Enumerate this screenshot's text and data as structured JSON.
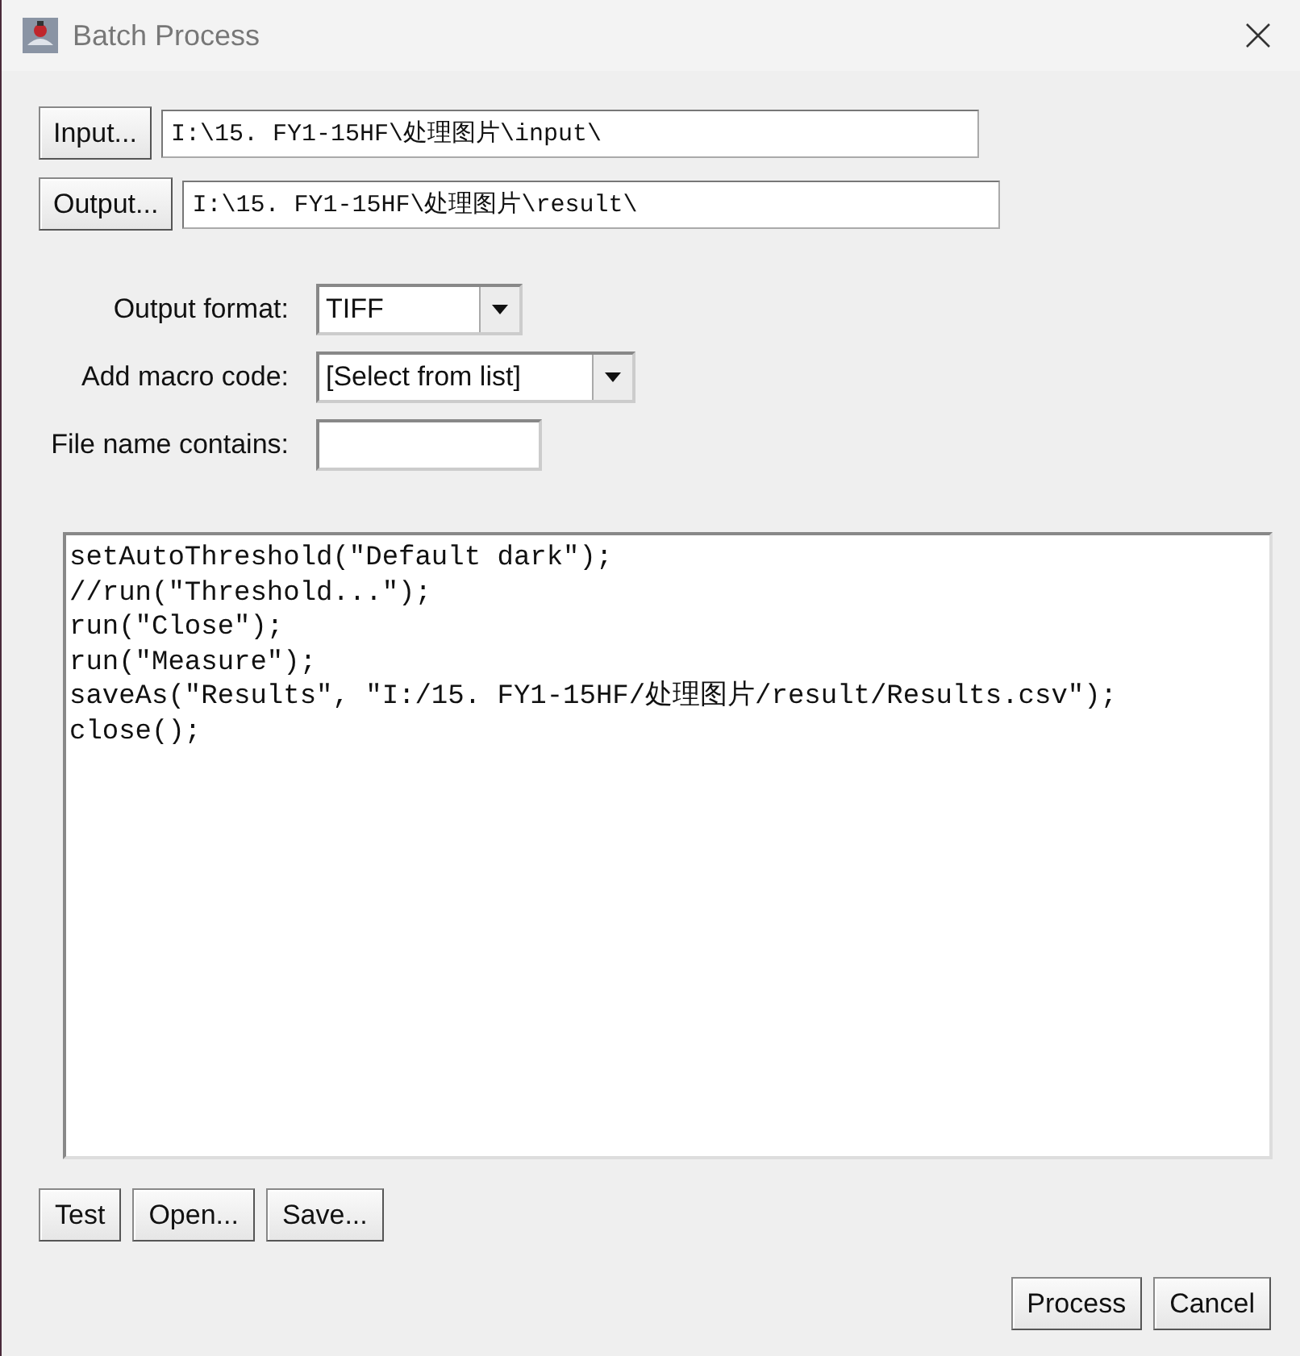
{
  "window": {
    "title": "Batch Process"
  },
  "input": {
    "button": "Input...",
    "value": "I:\\15. FY1-15HF\\处理图片\\input\\"
  },
  "output": {
    "button": "Output...",
    "value": "I:\\15. FY1-15HF\\处理图片\\result\\"
  },
  "options": [
    {
      "kind": "dropdown",
      "label": "Output format:",
      "value": "TIFF"
    },
    {
      "kind": "dropdown",
      "label": "Add macro code:",
      "value": "[Select from list]"
    },
    {
      "kind": "text",
      "label": "File name contains:"
    }
  ],
  "macro_code": [
    "setAutoThreshold(\"Default dark\");",
    "//run(\"Threshold...\");",
    "run(\"Close\");",
    "run(\"Measure\");",
    "saveAs(\"Results\", \"I:/15. FY1-15HF/处理图片/result/Results.csv\");",
    "close();"
  ],
  "editor_buttons": [
    "Test",
    "Open...",
    "Save..."
  ],
  "dialog_buttons": [
    "Process",
    "Cancel"
  ]
}
